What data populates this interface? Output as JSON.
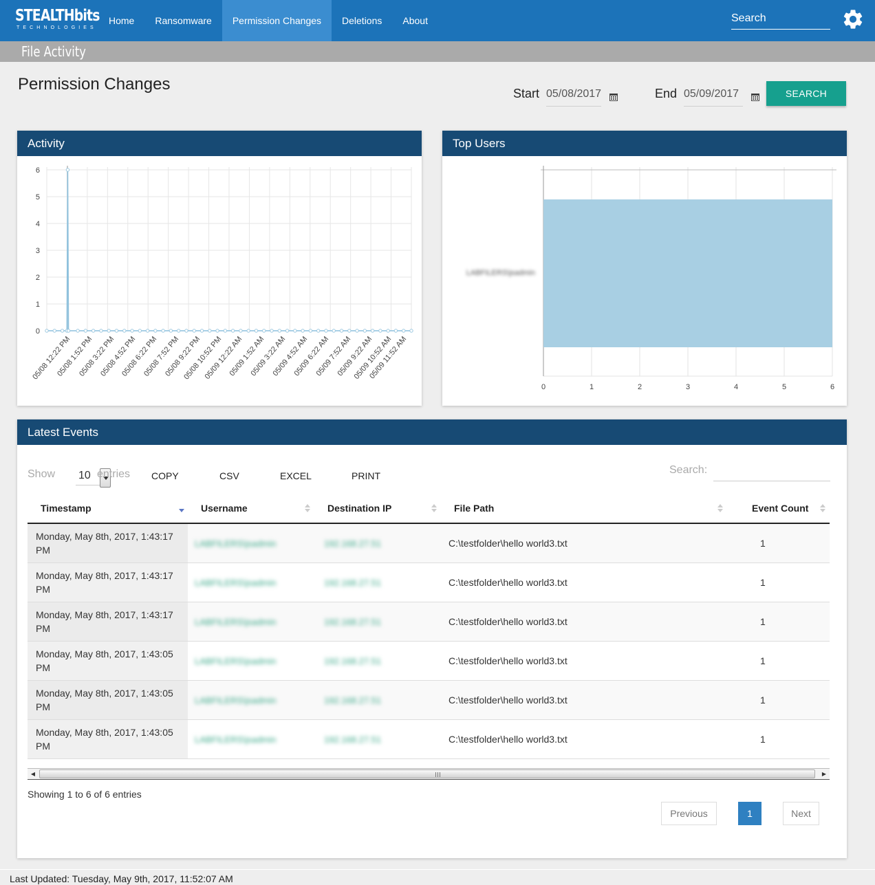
{
  "brand": {
    "name": "STEALTHbits",
    "tagline": "TECHNOLOGIES"
  },
  "nav": {
    "items": [
      {
        "label": "Home"
      },
      {
        "label": "Ransomware"
      },
      {
        "label": "Permission Changes",
        "active": true
      },
      {
        "label": "Deletions"
      },
      {
        "label": "About"
      }
    ],
    "search_placeholder": "Search",
    "settings_icon": "gear-icon"
  },
  "subheader": {
    "title": "File Activity"
  },
  "page": {
    "title": "Permission Changes",
    "start_label": "Start",
    "start_date": "05/08/2017",
    "end_label": "End",
    "end_date": "05/09/2017",
    "search_button": "SEARCH",
    "calendar_icon": "calendar-icon"
  },
  "colors": {
    "navbar": "#1c73b9",
    "nav_active": "#3b8dd0",
    "panel_header": "#174a74",
    "search_button": "#16a08e",
    "chart_fill": "#a8cfe3",
    "pagination_current": "#2f80c1"
  },
  "activity_panel": {
    "title": "Activity",
    "chart_data": {
      "type": "area",
      "title": "",
      "xlabel": "",
      "ylabel": "",
      "ylim": [
        0,
        6
      ],
      "y_ticks": [
        0,
        1,
        2,
        3,
        4,
        5,
        6
      ],
      "x_tick_labels": [
        "05/08 12:22 PM",
        "05/08 1:52 PM",
        "05/08 3:22 PM",
        "05/08 4:52 PM",
        "05/08 6:22 PM",
        "05/08 7:52 PM",
        "05/08 9:22 PM",
        "05/08 10:52 PM",
        "05/09 12:22 AM",
        "05/09 1:52 AM",
        "05/09 3:22 AM",
        "05/09 4:52 AM",
        "05/09 6:22 AM",
        "05/09 7:52 AM",
        "05/09 9:22 AM",
        "05/09 10:52 AM",
        "05/09 11:52 AM"
      ],
      "x_start_minutes": 742,
      "x_end_minutes": 2152,
      "series": [
        {
          "points": [
            [
              742,
              0
            ],
            [
              772,
              0
            ],
            [
              802,
              0
            ],
            [
              820,
              0
            ],
            [
              823,
              6
            ],
            [
              826,
              0
            ],
            [
              862,
              0
            ],
            [
              892,
              0
            ],
            [
              922,
              0
            ],
            [
              952,
              0
            ],
            [
              982,
              0
            ],
            [
              1012,
              0
            ],
            [
              1042,
              0
            ],
            [
              1072,
              0
            ],
            [
              1102,
              0
            ],
            [
              1132,
              0
            ],
            [
              1162,
              0
            ],
            [
              1192,
              0
            ],
            [
              1222,
              0
            ],
            [
              1252,
              0
            ],
            [
              1282,
              0
            ],
            [
              1312,
              0
            ],
            [
              1342,
              0
            ],
            [
              1372,
              0
            ],
            [
              1402,
              0
            ],
            [
              1432,
              0
            ],
            [
              1462,
              0
            ],
            [
              1492,
              0
            ],
            [
              1522,
              0
            ],
            [
              1552,
              0
            ],
            [
              1582,
              0
            ],
            [
              1612,
              0
            ],
            [
              1642,
              0
            ],
            [
              1672,
              0
            ],
            [
              1702,
              0
            ],
            [
              1732,
              0
            ],
            [
              1762,
              0
            ],
            [
              1792,
              0
            ],
            [
              1822,
              0
            ],
            [
              1852,
              0
            ],
            [
              1882,
              0
            ],
            [
              1912,
              0
            ],
            [
              1942,
              0
            ],
            [
              1972,
              0
            ],
            [
              2002,
              0
            ],
            [
              2032,
              0
            ],
            [
              2062,
              0
            ],
            [
              2092,
              0
            ],
            [
              2122,
              0
            ],
            [
              2152,
              0
            ]
          ]
        }
      ],
      "grid": true
    }
  },
  "top_users_panel": {
    "title": "Top Users",
    "chart_data": {
      "type": "bar",
      "orientation": "horizontal",
      "categories": [
        "LABFILERS\\jsadmin"
      ],
      "values": [
        6
      ],
      "xlim": [
        0,
        6
      ],
      "x_ticks": [
        0,
        1,
        2,
        3,
        4,
        5,
        6
      ],
      "grid": true
    }
  },
  "events_panel": {
    "title": "Latest Events",
    "show_label": "Show",
    "entries_label": "entries",
    "page_length": "10",
    "export_buttons": [
      "COPY",
      "CSV",
      "EXCEL",
      "PRINT"
    ],
    "search_label": "Search:",
    "columns": [
      "Timestamp",
      "Username",
      "Destination IP",
      "File Path",
      "Event Count"
    ],
    "rows": [
      [
        "Monday, May 8th, 2017, 1:43:17 PM",
        "LABFILERS\\jsadmin",
        "192.168.27.51",
        "C:\\testfolder\\hello world3.txt",
        "1"
      ],
      [
        "Monday, May 8th, 2017, 1:43:17 PM",
        "LABFILERS\\jsadmin",
        "192.168.27.51",
        "C:\\testfolder\\hello world3.txt",
        "1"
      ],
      [
        "Monday, May 8th, 2017, 1:43:17 PM",
        "LABFILERS\\jsadmin",
        "192.168.27.51",
        "C:\\testfolder\\hello world3.txt",
        "1"
      ],
      [
        "Monday, May 8th, 2017, 1:43:05 PM",
        "LABFILERS\\jsadmin",
        "192.168.27.51",
        "C:\\testfolder\\hello world3.txt",
        "1"
      ],
      [
        "Monday, May 8th, 2017, 1:43:05 PM",
        "LABFILERS\\jsadmin",
        "192.168.27.51",
        "C:\\testfolder\\hello world3.txt",
        "1"
      ],
      [
        "Monday, May 8th, 2017, 1:43:05 PM",
        "LABFILERS\\jsadmin",
        "192.168.27.51",
        "C:\\testfolder\\hello world3.txt",
        "1"
      ]
    ],
    "info": "Showing 1 to 6 of 6 entries",
    "pagination": {
      "previous": "Previous",
      "current": "1",
      "next": "Next"
    }
  },
  "footer": {
    "last_updated": "Last Updated: Tuesday, May 9th, 2017, 11:52:07 AM"
  }
}
